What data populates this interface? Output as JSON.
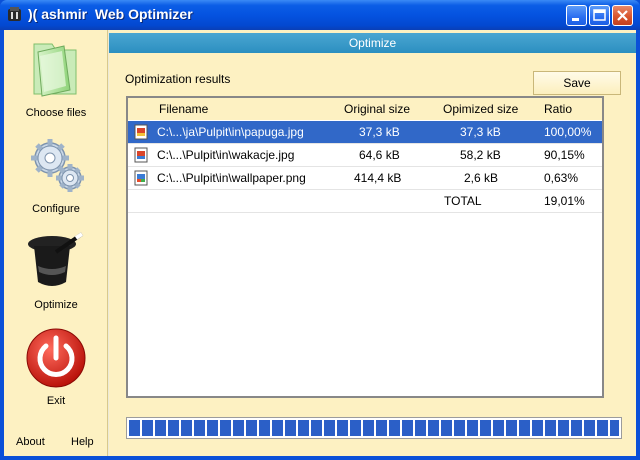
{
  "window": {
    "title": ")( ashmir  Web Optimizer",
    "minimize_label": "minimize",
    "maximize_label": "maximize",
    "close_label": "close"
  },
  "sidebar": {
    "items": [
      {
        "label": "Choose files",
        "icon": "folder-icon"
      },
      {
        "label": "Configure",
        "icon": "gears-icon"
      },
      {
        "label": "Optimize",
        "icon": "magic-hat-icon"
      },
      {
        "label": "Exit",
        "icon": "power-icon"
      }
    ],
    "about_label": "About",
    "help_label": "Help"
  },
  "main": {
    "header": "Optimize",
    "results_label": "Optimization results",
    "save_label": "Save",
    "columns": [
      "Filename",
      "Original size",
      "Opimized size",
      "Ratio"
    ],
    "rows": [
      {
        "filename": "C:\\...\\ja\\Pulpit\\in\\papuga.jpg",
        "original": "37,3 kB",
        "optimized": "37,3 kB",
        "ratio": "100,00%",
        "selected": true
      },
      {
        "filename": "C:\\...\\Pulpit\\in\\wakacje.jpg",
        "original": "64,6 kB",
        "optimized": "58,2 kB",
        "ratio": "90,15%",
        "selected": false
      },
      {
        "filename": "C:\\...\\Pulpit\\in\\wallpaper.png",
        "original": "414,4 kB",
        "optimized": "2,6 kB",
        "ratio": "0,63%",
        "selected": false
      }
    ],
    "total_label": "TOTAL",
    "total_ratio": "19,01%",
    "progress": 1.0
  },
  "colors": {
    "titlebar": "#0553e0",
    "sidebar_bg": "#fdf1c2",
    "header_bar": "#2c8fc0",
    "selection": "#3168c8",
    "progress": "#2b5fc7"
  }
}
